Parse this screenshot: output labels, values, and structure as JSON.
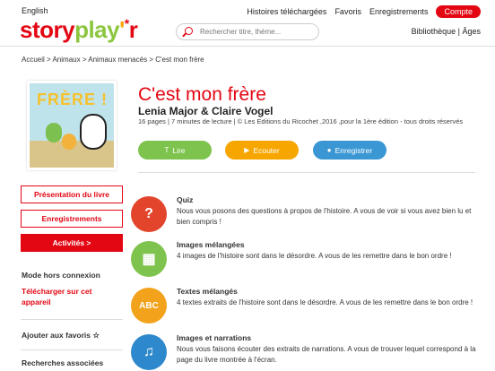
{
  "header": {
    "lang": "English",
    "logo": {
      "p1": "story",
      "p2": "play",
      "p3": "'",
      "p4": "r",
      "star": "*"
    },
    "search_placeholder": "Rechercher titre, thème...",
    "links": [
      "Histoires téléchargées",
      "Favoris",
      "Enregistrements"
    ],
    "account_label": "Compte",
    "subnav": "Bibliothèque  |  Âges"
  },
  "breadcrumb": "Accueil > Animaux > Animaux menacés > C'est mon frère",
  "book": {
    "cover_title": "FRÈRE !",
    "title": "C'est mon frère",
    "authors": "Lenia Major & Claire Vogel",
    "meta": "16 pages | 7 minutes de lecture | © Les Editions du Ricochet ,2016 ,pour la 1ère édition - tous droits réservés"
  },
  "actions": {
    "read": "Lire",
    "listen": "Ecouter",
    "record": "Enregistrer"
  },
  "sidebar": {
    "presentation": "Présentation du livre",
    "recordings": "Enregistrements",
    "activities": "Activités >",
    "offline_heading": "Mode hors connexion",
    "download": "Télécharger sur cet appareil",
    "favorite": "Ajouter aux favoris ☆",
    "related": "Recherches associées"
  },
  "activities": [
    {
      "title": "Quiz",
      "desc": "Nous vous posons des questions à propos de l'histoire. A vous de voir si vous avez bien lu et bien compris !",
      "icon": "?"
    },
    {
      "title": "Images mélangées",
      "desc": "4 images de l'histoire sont dans le désordre. A vous de les remettre dans le bon ordre !",
      "icon": "▦"
    },
    {
      "title": "Textes mélangés",
      "desc": "4 textes extraits de l'histoire sont dans le désordre. A vous de les remettre dans le bon ordre !",
      "icon": "ABC"
    },
    {
      "title": "Images et narrations",
      "desc": "Nous vous faisons écouter des extraits de narrations. A vous de trouver lequel correspond à la page du livre montrée à l'écran.",
      "icon": "♫"
    }
  ]
}
